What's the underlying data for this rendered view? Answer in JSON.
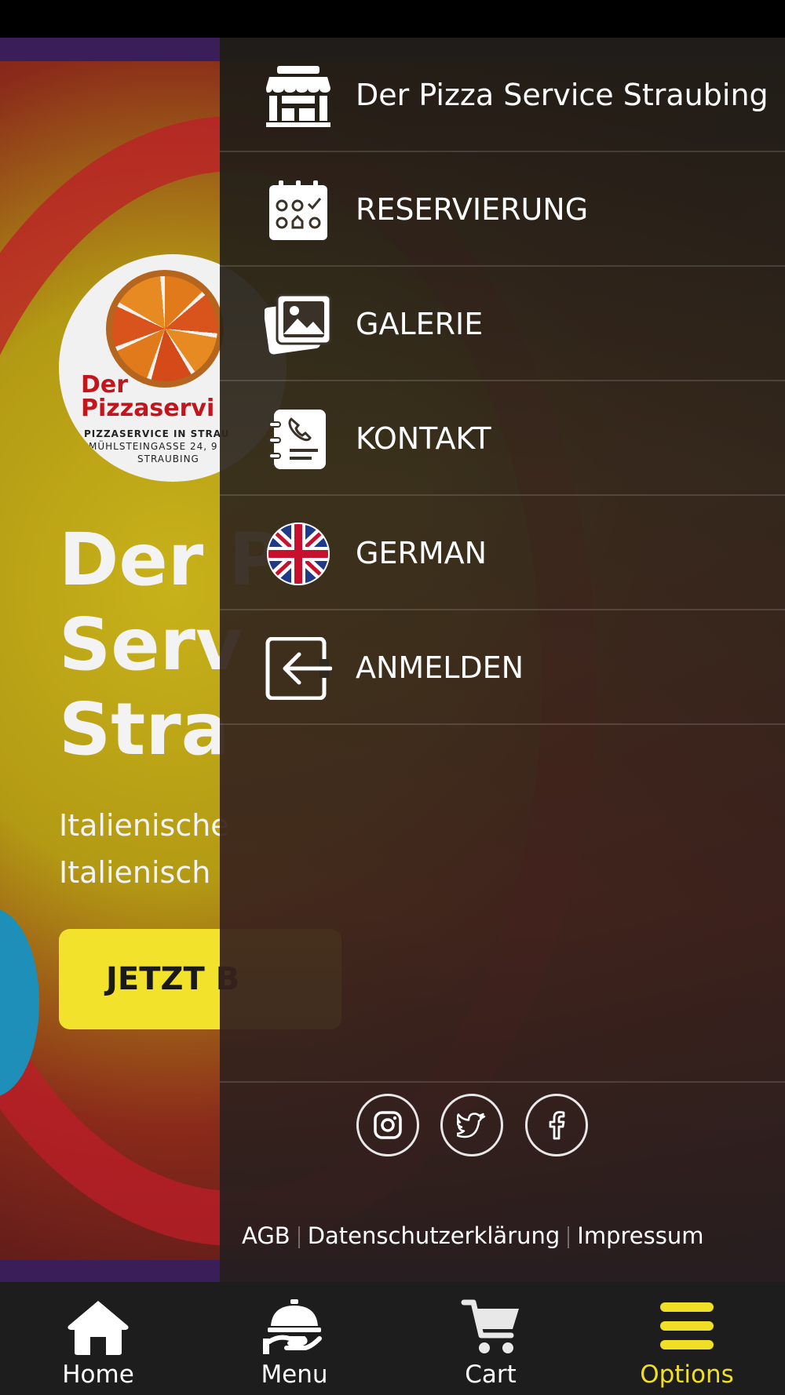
{
  "background": {
    "logo": {
      "title_line1": "Der",
      "title_line2": "Pizzaservi",
      "line1": "PIZZASERVICE IN STRAU",
      "line2": "MÜHLSTEINGASSE 24, 9",
      "line3": "STRAUBING"
    },
    "hero_title": "Der P\nServ\nStra",
    "hero_subtitle": "Italienische\nItalienisch",
    "cta_label": "JETZT B"
  },
  "drawer": {
    "items": [
      {
        "label": "Der Pizza Service Straubing",
        "icon": "store-icon"
      },
      {
        "label": "RESERVIERUNG",
        "icon": "calendar-icon"
      },
      {
        "label": "GALERIE",
        "icon": "gallery-icon"
      },
      {
        "label": "KONTAKT",
        "icon": "contact-icon"
      },
      {
        "label": "GERMAN",
        "icon": "uk-flag-icon"
      },
      {
        "label": "ANMELDEN",
        "icon": "login-icon"
      }
    ],
    "social": [
      "instagram-icon",
      "twitter-icon",
      "facebook-icon"
    ],
    "footer": {
      "agb": "AGB",
      "privacy": "Datenschutzerklärung",
      "imprint": "Impressum"
    }
  },
  "bottom_nav": {
    "items": [
      {
        "label": "Home",
        "icon": "home-icon"
      },
      {
        "label": "Menu",
        "icon": "cloche-icon"
      },
      {
        "label": "Cart",
        "icon": "cart-icon"
      },
      {
        "label": "Options",
        "icon": "hamburger-icon",
        "active": true
      }
    ]
  },
  "colors": {
    "accent": "#f0df24",
    "nav_background": "#1d1d1d",
    "cta": "#f2e22c"
  }
}
